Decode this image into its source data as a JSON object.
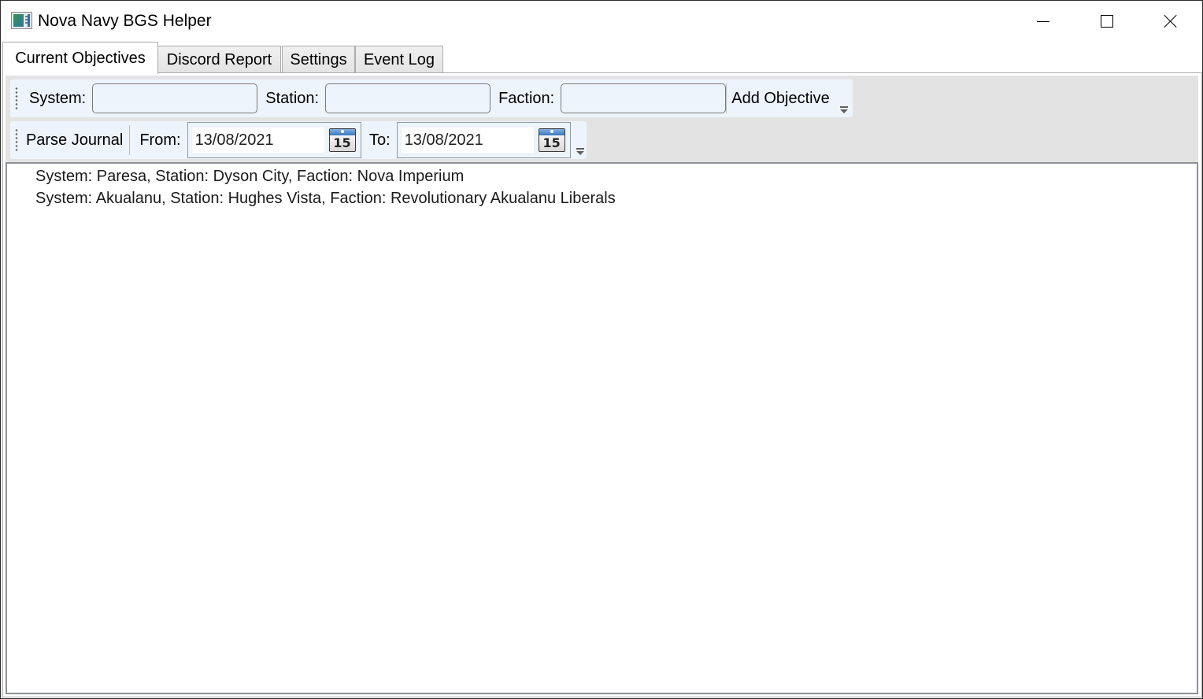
{
  "window": {
    "title": "Nova Navy BGS Helper",
    "icon": "app-icon",
    "controls": {
      "minimize": "minimize-icon",
      "maximize": "maximize-icon",
      "close": "close-icon"
    }
  },
  "tabs": [
    {
      "label": "Current Objectives",
      "active": true
    },
    {
      "label": "Discord Report",
      "active": false
    },
    {
      "label": "Settings",
      "active": false
    },
    {
      "label": "Event Log",
      "active": false
    }
  ],
  "objective_toolbar": {
    "system_label": "System:",
    "system_value": "",
    "station_label": "Station:",
    "station_value": "",
    "faction_label": "Faction:",
    "faction_value": "",
    "add_button": "Add Objective"
  },
  "journal_toolbar": {
    "parse_button": "Parse Journal",
    "from_label": "From:",
    "from_date": "13/08/2021",
    "to_label": "To:",
    "to_date": "13/08/2021",
    "calendar_day": "15"
  },
  "objectives": [
    "System: Paresa, Station: Dyson City, Faction: Nova Imperium",
    "System: Akualanu, Station: Hughes Vista, Faction: Revolutionary Akualanu Liberals"
  ]
}
